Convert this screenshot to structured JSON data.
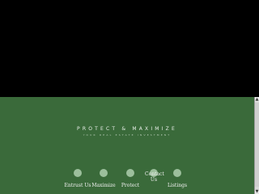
{
  "tagline": {
    "main": "PROTECT & MAXIMIZE",
    "sub": "YOUR REAL ESTATE INVESTMENT"
  },
  "nav": {
    "items": [
      {
        "label": "Entrust Us"
      },
      {
        "label": "Maximize"
      },
      {
        "label": "Protect"
      },
      {
        "label": "Contact Us"
      },
      {
        "label": "Listings"
      }
    ]
  },
  "scrollbar": {
    "up_icon": "▲",
    "down_icon": "▼"
  },
  "colors": {
    "background_green": "#3a6a3a",
    "dot_green": "#9cbf9c",
    "top_panel": "#000000"
  }
}
